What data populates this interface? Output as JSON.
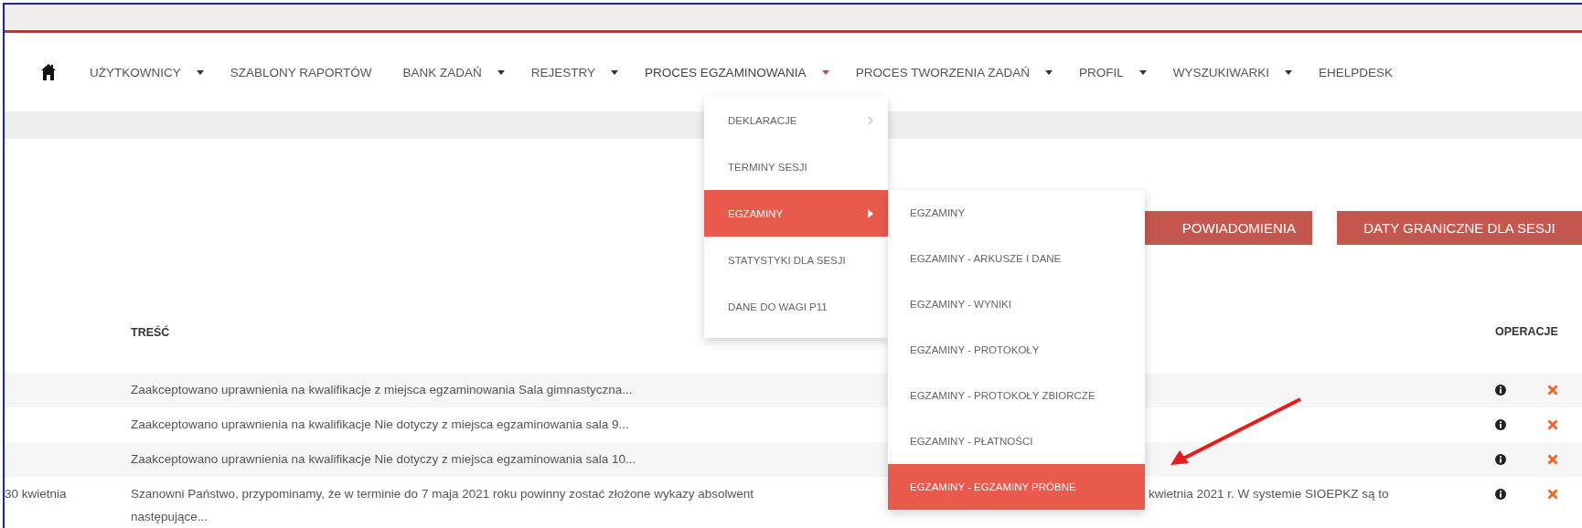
{
  "nav": {
    "items": [
      {
        "label": "UŻYTKOWNICY",
        "dropdown": true,
        "selected": false
      },
      {
        "label": "SZABLONY RAPORTÓW",
        "dropdown": false,
        "selected": false
      },
      {
        "label": "BANK ZADAŃ",
        "dropdown": true,
        "selected": false
      },
      {
        "label": "REJESTRY",
        "dropdown": true,
        "selected": false
      },
      {
        "label": "PROCES EGZAMINOWANIA",
        "dropdown": true,
        "selected": true
      },
      {
        "label": "PROCES TWORZENIA ZADAŃ",
        "dropdown": true,
        "selected": false
      },
      {
        "label": "PROFIL",
        "dropdown": true,
        "selected": false
      },
      {
        "label": "WYSZUKIWARKI",
        "dropdown": true,
        "selected": false
      },
      {
        "label": "EHELPDESK",
        "dropdown": false,
        "selected": false
      }
    ]
  },
  "menu": {
    "items": [
      {
        "label": "DEKLARACJE",
        "submenu": true,
        "selected": false
      },
      {
        "label": "TERMINY SESJI",
        "submenu": false,
        "selected": false
      },
      {
        "label": "EGZAMINY",
        "submenu": true,
        "selected": true
      },
      {
        "label": "STATYSTYKI DLA SESJI",
        "submenu": false,
        "selected": false
      },
      {
        "label": "DANE DO WAGI P11",
        "submenu": false,
        "selected": false
      }
    ]
  },
  "submenu": {
    "items": [
      {
        "label": "EGZAMINY",
        "selected": false
      },
      {
        "label": "EGZAMINY - ARKUSZE I DANE",
        "selected": false
      },
      {
        "label": "EGZAMINY - WYNIKI",
        "selected": false
      },
      {
        "label": "EGZAMINY - PROTOKOŁY",
        "selected": false
      },
      {
        "label": "EGZAMINY - PROTOKOŁY ZBIORCZE",
        "selected": false
      },
      {
        "label": "EGZAMINY - PŁATNOŚCI",
        "selected": false
      },
      {
        "label": "EGZAMINY - EGZAMINY PRÓBNE",
        "selected": true
      }
    ]
  },
  "buttons": [
    "POWIADOMIENIA",
    "DATY GRANICZNE DLA SESJI"
  ],
  "table": {
    "columns": [
      "TREŚĆ",
      "OPERACJE"
    ],
    "rows": [
      {
        "text": "Zaakceptowano uprawnienia na kwalifikacje z miejsca egzaminowania Sala gimnastyczna..."
      },
      {
        "text": "Zaakceptowano uprawnienia na kwalifikacje Nie dotyczy z miejsca egzaminowania sala 9..."
      },
      {
        "text": "Zaakceptowano uprawnienia na kwalifikacje Nie dotyczy z miejsca egzaminowania sala 10..."
      },
      {
        "column_1": "30 kwietnia",
        "text": "Szanowni Państwo, przypominamy, że w terminie do 7 maja 2021 roku powinny zostać złożone wykazy absolwent",
        "text_after_menu": "kwietnia 2021 r. W systemie SIOEPKZ są to",
        "continuation": "następujące..."
      }
    ]
  }
}
